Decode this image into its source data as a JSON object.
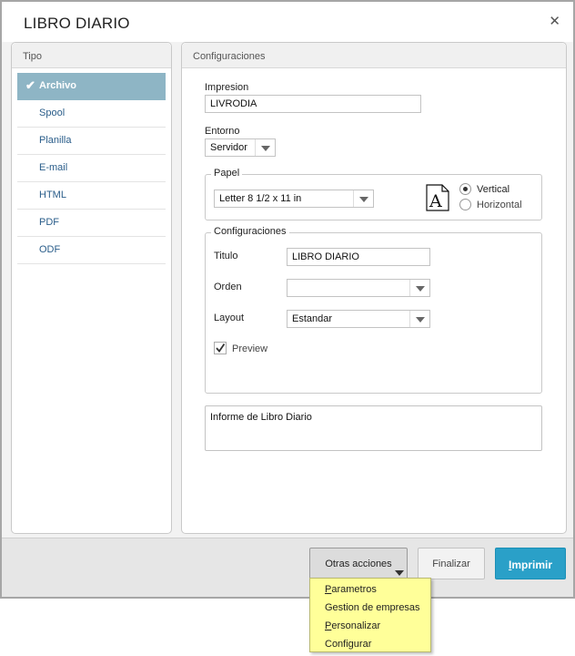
{
  "dialog": {
    "title": "LIBRO DIARIO",
    "close_glyph": "✕"
  },
  "left_panel": {
    "header": "Tipo",
    "items": [
      {
        "label": "Archivo",
        "active": true
      },
      {
        "label": "Spool"
      },
      {
        "label": "Planilla"
      },
      {
        "label": "E-mail"
      },
      {
        "label": "HTML"
      },
      {
        "label": "PDF"
      },
      {
        "label": "ODF"
      }
    ]
  },
  "right_panel": {
    "header": "Configuraciones",
    "impresion": {
      "label": "Impresion",
      "value": "LIVRODIA"
    },
    "entorno": {
      "label": "Entorno",
      "value": "Servidor"
    },
    "papel": {
      "legend": "Papel",
      "size": "Letter 8 1/2 x 11 in",
      "orientation_vertical": "Vertical",
      "orientation_horizontal": "Horizontal",
      "selected": "Vertical"
    },
    "config": {
      "legend": "Configuraciones",
      "titulo_label": "Titulo",
      "titulo_value": "LIBRO DIARIO",
      "orden_label": "Orden",
      "orden_value": "",
      "layout_label": "Layout",
      "layout_value": "Estandar",
      "preview_label": "Preview",
      "preview_checked": true
    },
    "description": "Informe de Libro Diario"
  },
  "footer": {
    "other_actions": "Otras acciones",
    "finalizar": "Finalizar",
    "imprimir_first": "I",
    "imprimir_rest": "mprimir"
  },
  "menu": {
    "items": [
      {
        "first": "P",
        "rest": "arametros"
      },
      {
        "first": "",
        "rest": "Gestion de empresas"
      },
      {
        "first": "P",
        "rest": "ersonalizar"
      },
      {
        "first": "",
        "rest": "Configurar"
      }
    ]
  },
  "colors": {
    "accent": "#2aa0c8",
    "active_nav": "#8eb5c5",
    "menu_bg": "#ffff99"
  }
}
